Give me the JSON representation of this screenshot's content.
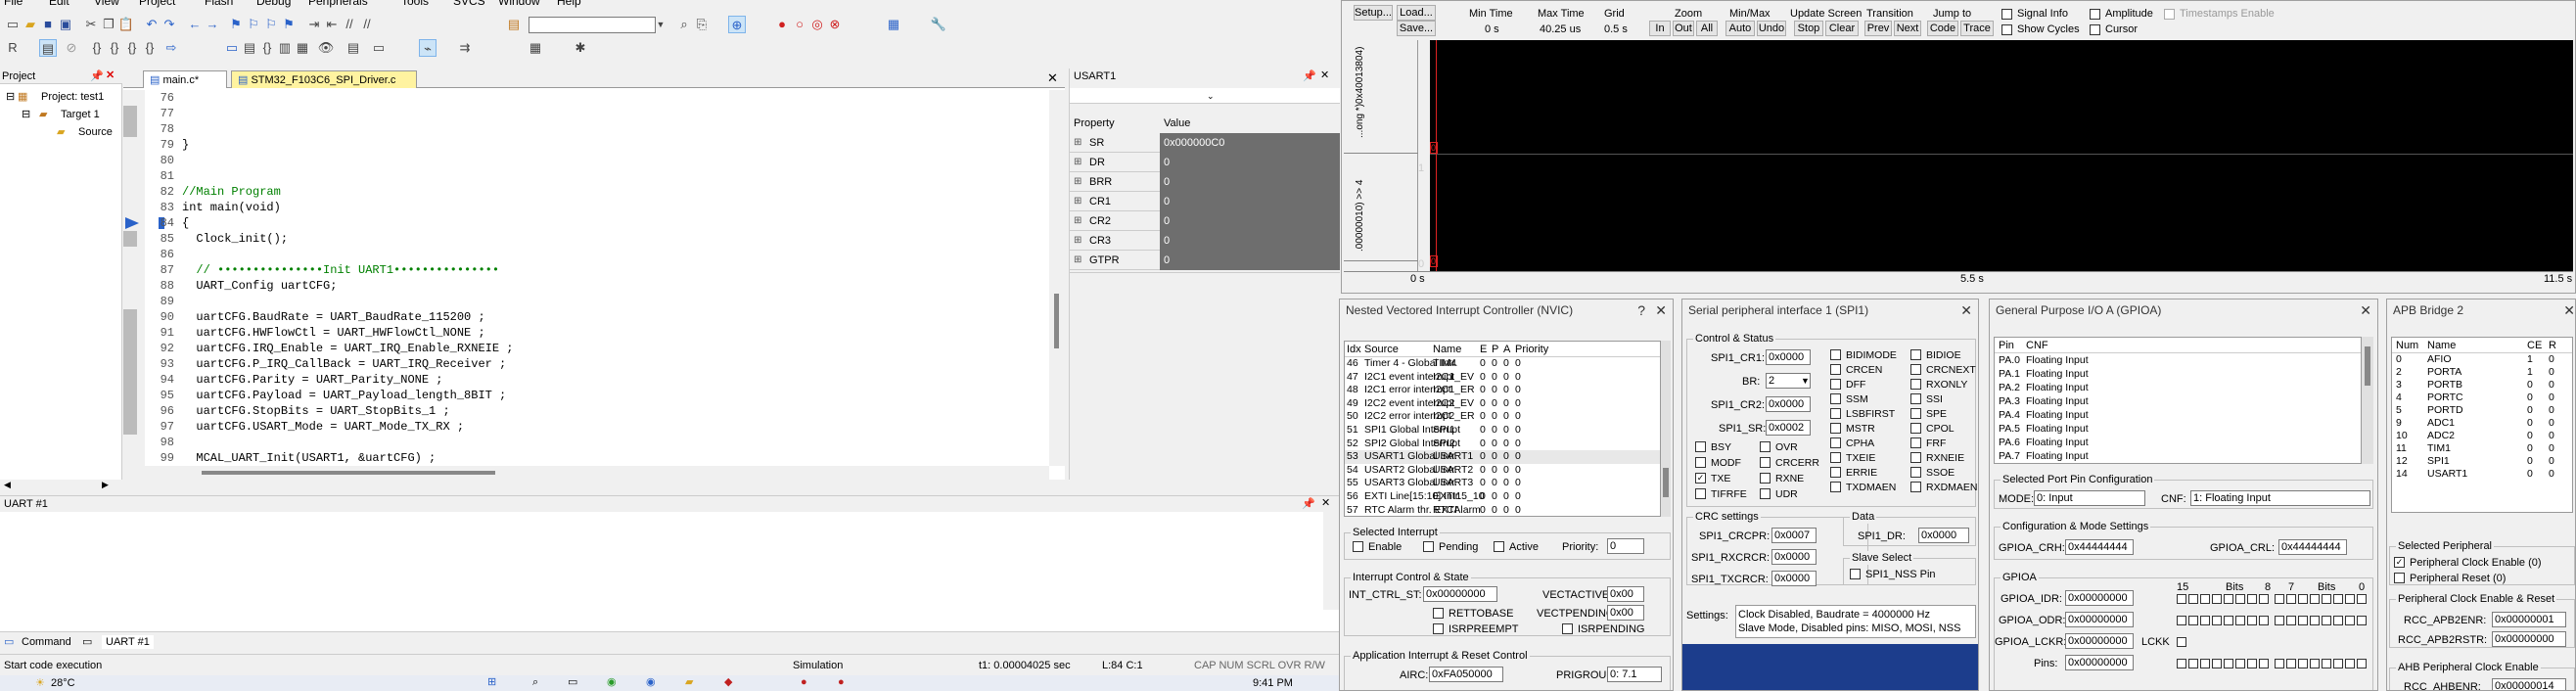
{
  "menu": [
    "File",
    "Edit",
    "View",
    "Project",
    "Flash",
    "Debug",
    "Peripherals",
    "Tools",
    "SVCS",
    "Window",
    "Help"
  ],
  "project_panel": {
    "title": "Project",
    "root": "Project: test1",
    "target": "Target 1",
    "source": "Source"
  },
  "editor": {
    "tabs": [
      "main.c*",
      "STM32_F103C6_SPI_Driver.c"
    ],
    "lines": [
      {
        "n": "76",
        "t": ""
      },
      {
        "n": "77",
        "t": ""
      },
      {
        "n": "78",
        "t": ""
      },
      {
        "n": "79",
        "t": "}"
      },
      {
        "n": "80",
        "t": ""
      },
      {
        "n": "81",
        "t": ""
      },
      {
        "n": "82",
        "t": "//Main Program"
      },
      {
        "n": "83",
        "t": "int main(void)"
      },
      {
        "n": "84",
        "t": "{"
      },
      {
        "n": "85",
        "t": "  Clock_init();"
      },
      {
        "n": "86",
        "t": ""
      },
      {
        "n": "87",
        "t": "  // •••••••••••••••Init UART1•••••••••••••••"
      },
      {
        "n": "88",
        "t": "  UART_Config uartCFG;"
      },
      {
        "n": "89",
        "t": ""
      },
      {
        "n": "90",
        "t": "  uartCFG.BaudRate = UART_BaudRate_115200 ;"
      },
      {
        "n": "91",
        "t": "  uartCFG.HWFlowCtl = UART_HWFlowCtl_NONE ;"
      },
      {
        "n": "92",
        "t": "  uartCFG.IRQ_Enable = UART_IRQ_Enable_RXNEIE ;"
      },
      {
        "n": "93",
        "t": "  uartCFG.P_IRQ_CallBack = UART_IRQ_Receiver ;"
      },
      {
        "n": "94",
        "t": "  uartCFG.Parity = UART_Parity_NONE ;"
      },
      {
        "n": "95",
        "t": "  uartCFG.Payload = UART_Payload_length_8BIT ;"
      },
      {
        "n": "96",
        "t": "  uartCFG.StopBits = UART_StopBits_1 ;"
      },
      {
        "n": "97",
        "t": "  uartCFG.USART_Mode = UART_Mode_TX_RX ;"
      },
      {
        "n": "98",
        "t": ""
      },
      {
        "n": "99",
        "t": "  MCAL_UART_Init(USART1, &uartCFG) ;"
      }
    ]
  },
  "usart_panel": {
    "title": "USART1",
    "col_property": "Property",
    "col_value": "Value",
    "rows": [
      {
        "p": "SR",
        "v": "0x000000C0"
      },
      {
        "p": "DR",
        "v": "0"
      },
      {
        "p": "BRR",
        "v": "0"
      },
      {
        "p": "CR1",
        "v": "0"
      },
      {
        "p": "CR2",
        "v": "0"
      },
      {
        "p": "CR3",
        "v": "0"
      },
      {
        "p": "GTPR",
        "v": "0"
      }
    ]
  },
  "uart_output": {
    "title": "UART #1",
    "tab_command": "Command",
    "tab_uart": "UART #1"
  },
  "status": {
    "left": "Start code execution",
    "mid": "Simulation",
    "t1": "t1: 0.00004025 sec",
    "pos": "L:84 C:1",
    "caps": "CAP  NUM  SCRL  OVR  R/W"
  },
  "taskbar": {
    "temp": "28°C",
    "time": "9:41 PM"
  },
  "logic": {
    "setup": "Setup...",
    "load": "Load...",
    "save": "Save...",
    "min_time_l": "Min Time",
    "min_time_v": "0 s",
    "max_time_l": "Max Time",
    "max_time_v": "40.25 us",
    "grid_l": "Grid",
    "grid_v": "0.5 s",
    "zoom_l": "Zoom",
    "zoom_in": "In",
    "zoom_out": "Out",
    "zoom_all": "All",
    "minmax_l": "Min/Max",
    "auto": "Auto",
    "undo": "Undo",
    "update_l": "Update Screen",
    "stop": "Stop",
    "clear": "Clear",
    "trans_l": "Transition",
    "prev": "Prev",
    "next": "Next",
    "jump_l": "Jump to",
    "code": "Code",
    "trace": "Trace",
    "signal_info": "Signal Info",
    "show_cycles": "Show Cycles",
    "amplitude": "Amplitude",
    "cursor": "Cursor",
    "timestamps": "Timestamps Enable",
    "sig1": "...ong *)0x40013804)",
    "sig2": ".00000010) >> 4",
    "axis_0": "0 s",
    "axis_mid": "5.5 s",
    "axis_end": "11.5 s",
    "one": "1",
    "zero": "0"
  },
  "nvic": {
    "title": "Nested Vectored Interrupt Controller (NVIC)",
    "headers": [
      "Idx",
      "Source",
      "Name",
      "E",
      "P",
      "A",
      "Priority"
    ],
    "rows": [
      [
        "46",
        "Timer 4 - Global Intr.",
        "TIM4",
        "0",
        "0",
        "0",
        "0"
      ],
      [
        "47",
        "I2C1 event interrupt",
        "I2C1_EV",
        "0",
        "0",
        "0",
        "0"
      ],
      [
        "48",
        "I2C1 error interrupt",
        "I2C1_ER",
        "0",
        "0",
        "0",
        "0"
      ],
      [
        "49",
        "I2C2 event interrupt",
        "I2C2_EV",
        "0",
        "0",
        "0",
        "0"
      ],
      [
        "50",
        "I2C2 error interrupt",
        "I2C2_ER",
        "0",
        "0",
        "0",
        "0"
      ],
      [
        "51",
        "SPI1 Global Interrupt",
        "SPI1",
        "0",
        "0",
        "0",
        "0"
      ],
      [
        "52",
        "SPI2 Global Interrupt",
        "SPI2",
        "0",
        "0",
        "0",
        "0"
      ],
      [
        "53",
        "USART1 Global Intr.",
        "USART1",
        "0",
        "0",
        "0",
        "0"
      ],
      [
        "54",
        "USART2 Global Intr.",
        "USART2",
        "0",
        "0",
        "0",
        "0"
      ],
      [
        "55",
        "USART3 Global Intr.",
        "USART3",
        "0",
        "0",
        "0",
        "0"
      ],
      [
        "56",
        "EXTI Line[15:10] Intr.",
        "EXTI15_10",
        "0",
        "0",
        "0",
        "0"
      ],
      [
        "57",
        "RTC Alarm thr. EXTI",
        "RTCAlarm",
        "0",
        "0",
        "0",
        "0"
      ]
    ],
    "sel_title": "Selected Interrupt",
    "enable": "Enable",
    "pending": "Pending",
    "active": "Active",
    "priority_l": "Priority:",
    "priority_v": "0",
    "ics_title": "Interrupt Control & State",
    "ictrl_l": "INT_CTRL_ST:",
    "ictrl_v": "0x00000000",
    "vecactive_l": "VECTACTIVE:",
    "vecactive_v": "0x00",
    "rettobase": "RETTOBASE",
    "vecpending_l": "VECTPENDING:",
    "vecpending_v": "0x00",
    "isrpreempt": "ISRPREEMPT",
    "isrpending": "ISRPENDING",
    "air_title": "Application Interrupt & Reset Control",
    "airc_l": "AIRC:",
    "airc_v": "0xFA050000",
    "prigroup_l": "PRIGROUP:",
    "prigroup_v": "0: 7.1"
  },
  "spi": {
    "title": "Serial peripheral interface 1 (SPI1)",
    "cs_title": "Control & Status",
    "cr1_l": "SPI1_CR1:",
    "cr1_v": "0x0000",
    "br_l": "BR:",
    "br_v": "2",
    "cr2_l": "SPI1_CR2:",
    "cr2_v": "0x0000",
    "sr_l": "SPI1_SR:",
    "sr_v": "0x0002",
    "flags_c1": [
      "BIDIMODE",
      "CRCEN",
      "DFF",
      "SSM",
      "LSBFIRST",
      "MSTR",
      "CPHA",
      "TXEIE",
      "ERRIE",
      "TXDMAEN"
    ],
    "flags_c2": [
      "BIDIOE",
      "CRCNEXT",
      "RXONLY",
      "SSI",
      "SPE",
      "CPOL",
      "FRF",
      "RXNEIE",
      "SSOE",
      "RXDMAEN"
    ],
    "flags_l": [
      "BSY",
      "MODF",
      "TXE",
      "TIFRFE"
    ],
    "flags_m": [
      "OVR",
      "CRCERR",
      "RXNE",
      "UDR"
    ],
    "crc_title": "CRC settings",
    "crcpr_l": "SPI1_CRCPR:",
    "crcpr_v": "0x0007",
    "rxcrcr_l": "SPI1_RXCRCR:",
    "rxcrcr_v": "0x0000",
    "txcrcr_l": "SPI1_TXCRCR:",
    "txcrcr_v": "0x0000",
    "data_title": "Data",
    "dr_l": "SPI1_DR:",
    "dr_v": "0x0000",
    "slave_title": "Slave Select",
    "nss": "SPI1_NSS Pin",
    "settings_l": "Settings:",
    "settings_1": "Clock Disabled, Baudrate = 4000000 Hz",
    "settings_2": "Slave Mode,  Disabled pins: MISO, MOSI, NSS"
  },
  "gpio": {
    "title": "General Purpose I/O A (GPIOA)",
    "h_pin": "Pin",
    "h_cnf": "CNF",
    "rows": [
      [
        "PA.0",
        "Floating Input"
      ],
      [
        "PA.1",
        "Floating Input"
      ],
      [
        "PA.2",
        "Floating Input"
      ],
      [
        "PA.3",
        "Floating Input"
      ],
      [
        "PA.4",
        "Floating Input"
      ],
      [
        "PA.5",
        "Floating Input"
      ],
      [
        "PA.6",
        "Floating Input"
      ],
      [
        "PA.7",
        "Floating Input"
      ]
    ],
    "sel_title": "Selected Port Pin Configuration",
    "mode_l": "MODE:",
    "mode_v": "0: Input",
    "cnf_l": "CNF:",
    "cnf_v": "1: Floating Input",
    "cms_title": "Configuration & Mode Settings",
    "crh_l": "GPIOA_CRH:",
    "crh_v": "0x44444444",
    "crl_l": "GPIOA_CRL:",
    "crl_v": "0x44444444",
    "g_title": "GPIOA",
    "idr_l": "GPIOA_IDR:",
    "idr_v": "0x00000000",
    "odr_l": "GPIOA_ODR:",
    "odr_v": "0x00000000",
    "lckr_l": "GPIOA_LCKR:",
    "lckr_v": "0x00000000",
    "pins_l": "Pins:",
    "pins_v": "0x00000000",
    "bits": "Bits",
    "b15": "15",
    "b8": "8",
    "b7": "7",
    "b0": "0",
    "lckk": "LCKK"
  },
  "apb": {
    "title": "APB Bridge 2",
    "headers": [
      "Num",
      "Name",
      "CE",
      "R"
    ],
    "rows": [
      [
        "0",
        "AFIO",
        "1",
        "0"
      ],
      [
        "2",
        "PORTA",
        "1",
        "0"
      ],
      [
        "3",
        "PORTB",
        "0",
        "0"
      ],
      [
        "4",
        "PORTC",
        "0",
        "0"
      ],
      [
        "5",
        "PORTD",
        "0",
        "0"
      ],
      [
        "9",
        "ADC1",
        "0",
        "0"
      ],
      [
        "10",
        "ADC2",
        "0",
        "0"
      ],
      [
        "11",
        "TIM1",
        "0",
        "0"
      ],
      [
        "12",
        "SPI1",
        "0",
        "0"
      ],
      [
        "14",
        "USART1",
        "0",
        "0"
      ]
    ],
    "sel_title": "Selected Peripheral",
    "clk_en": "Peripheral Clock Enable (0)",
    "reset": "Peripheral Reset (0)",
    "cer_title": "Peripheral Clock Enable & Reset",
    "enr_l": "RCC_APB2ENR:",
    "enr_v": "0x00000001",
    "rstr_l": "RCC_APB2RSTR:",
    "rstr_v": "0x00000000",
    "ahb_title": "AHB Peripheral Clock Enable",
    "ahbenr_l": "RCC_AHBENR:",
    "ahbenr_v": "0x00000014"
  }
}
